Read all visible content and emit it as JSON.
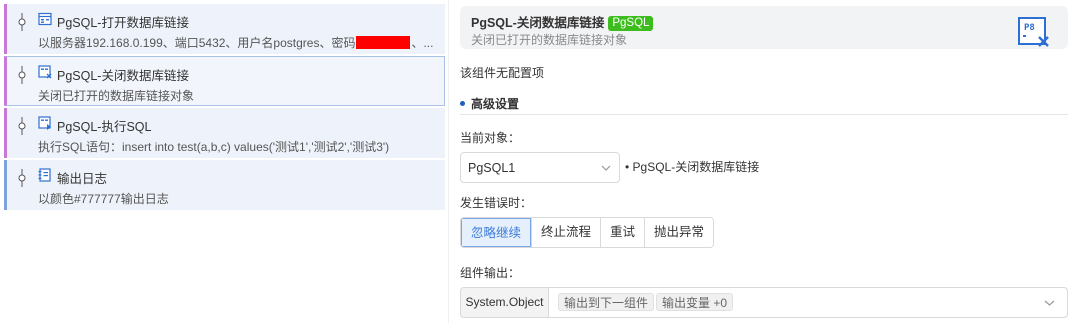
{
  "flow": {
    "steps": [
      {
        "title": "PgSQL-打开数据库链接",
        "desc_prefix": "以服务器192.168.0.199、端口5432、用户名postgres、密码",
        "desc_suffix": "、...",
        "icon": "database-open-icon"
      },
      {
        "title": "PgSQL-关闭数据库链接",
        "desc": "关闭已打开的数据库链接对象",
        "icon": "database-close-icon",
        "selected": true
      },
      {
        "title": "PgSQL-执行SQL",
        "desc": "执行SQL语句：insert into test(a,b,c) values('测试1','测试2','测试3')",
        "icon": "database-execute-icon"
      },
      {
        "title": "输出日志",
        "desc": "以颜色#777777输出日志",
        "icon": "log-icon"
      }
    ]
  },
  "panel": {
    "title": "PgSQL-关闭数据库链接",
    "tag": "PgSQL",
    "desc": "关闭已打开的数据库链接对象",
    "icon": "database-close-icon",
    "no_config": "该组件无配置项",
    "section": "高级设置",
    "current_object_label": "当前对象：",
    "current_object_value": "PgSQL1",
    "current_object_note": "• PgSQL-关闭数据库链接",
    "error_label": "发生错误时：",
    "error_options": [
      "忽略继续",
      "终止流程",
      "重试",
      "抛出异常"
    ],
    "error_selected": "忽略继续",
    "output_label": "组件输出：",
    "output_type": "System.Object",
    "output_chips": [
      "输出到下一组件",
      "输出变量 +0"
    ]
  },
  "colors": {
    "tag_green": "#3dbd1d",
    "accent_blue": "#3d7bd8",
    "step_border_purple": "#c879d8",
    "step_border_blue": "#7ea3d9",
    "redaction": "#ff0000"
  }
}
